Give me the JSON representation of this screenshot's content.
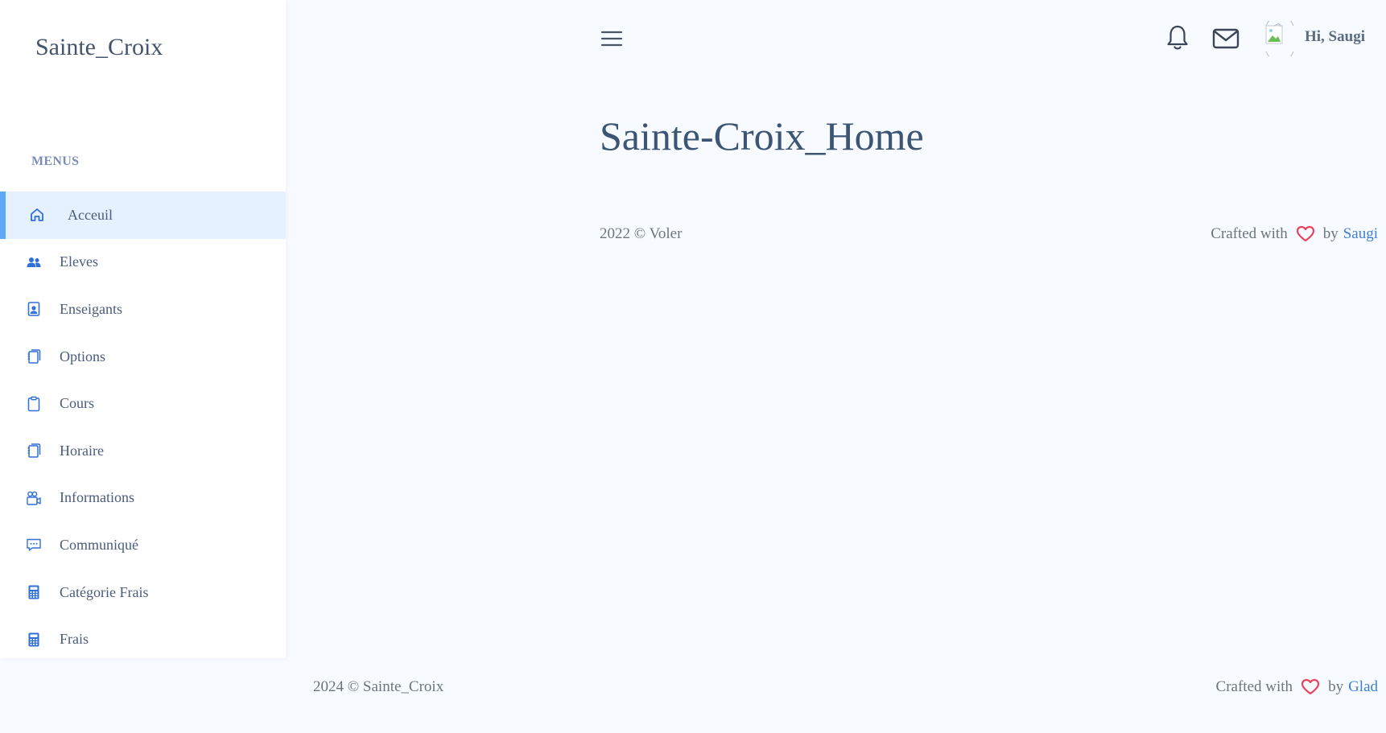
{
  "brand": "Sainte_Croix",
  "menu_title": "MENUS",
  "menu": [
    {
      "label": "Acceuil",
      "icon": "home-icon",
      "active": true
    },
    {
      "label": "Eleves",
      "icon": "users-icon"
    },
    {
      "label": "Enseigants",
      "icon": "person-badge-icon"
    },
    {
      "label": "Options",
      "icon": "journals-icon"
    },
    {
      "label": "Cours",
      "icon": "clipboard-icon"
    },
    {
      "label": "Horaire",
      "icon": "journals-icon"
    },
    {
      "label": "Informations",
      "icon": "people-video-icon"
    },
    {
      "label": "Communiqué",
      "icon": "chat-dots-icon"
    },
    {
      "label": "Catégorie Frais",
      "icon": "calculator-icon"
    },
    {
      "label": "Frais",
      "icon": "calculator-icon"
    }
  ],
  "header": {
    "greeting": "Hi, Saugi"
  },
  "page_title": "Sainte-Croix_Home",
  "inner_footer": {
    "left": "2022 © Voler",
    "crafted": "Crafted with",
    "by": "by",
    "author": "Saugi"
  },
  "footer": {
    "left": "2024 © Sainte_Croix",
    "crafted": "Crafted with",
    "by": "by",
    "author": "Glad"
  },
  "colors": {
    "accent": "#5fa8f5",
    "icon": "#2f6fd6",
    "heart": "#e8435a",
    "link": "#3f7fd6"
  }
}
